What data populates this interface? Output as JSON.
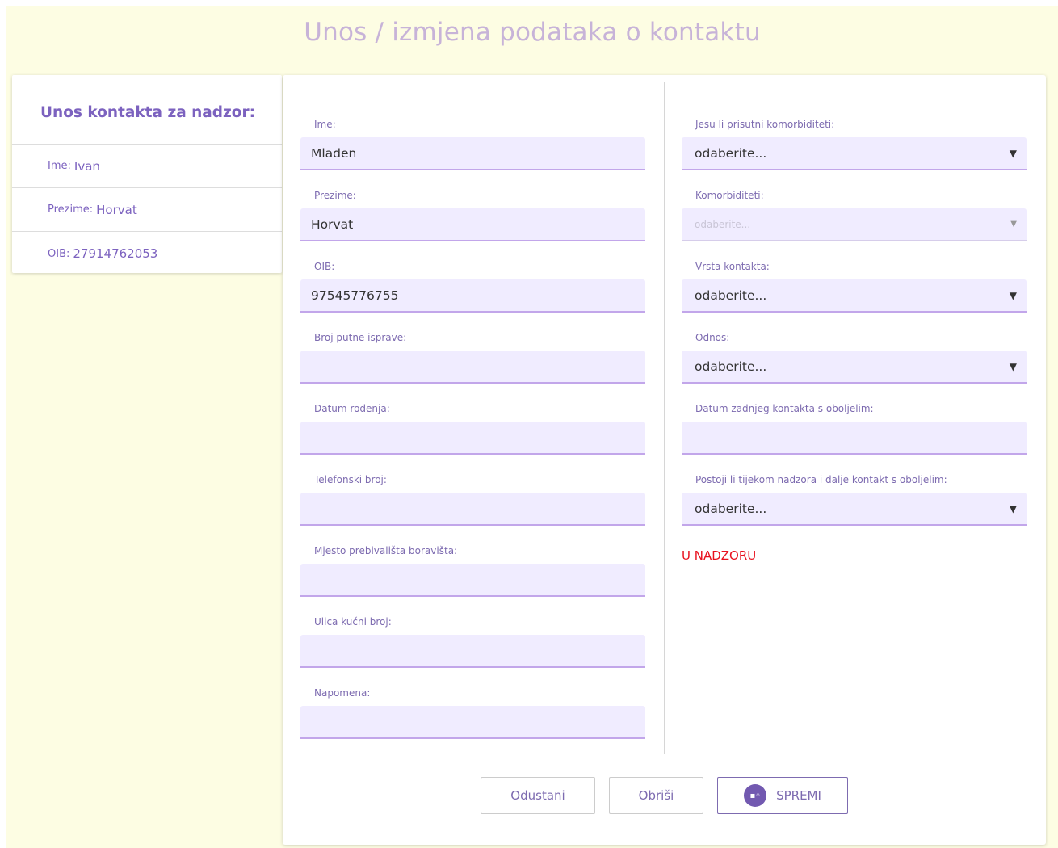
{
  "page_title": "Unos / izmjena podataka o kontaktu",
  "summary": {
    "heading": "Unos kontakta za nadzor:",
    "rows": [
      {
        "label": "Ime:",
        "value": "Ivan"
      },
      {
        "label": "Prezime:",
        "value": "Horvat"
      },
      {
        "label": "OIB:",
        "value": "27914762053"
      }
    ]
  },
  "form_left": [
    {
      "label": "Ime:",
      "value": "Mladen"
    },
    {
      "label": "Prezime:",
      "value": "Horvat"
    },
    {
      "label": "OIB:",
      "value": "97545776755"
    },
    {
      "label": "Broj putne isprave:",
      "value": ""
    },
    {
      "label": "Datum rođenja:",
      "value": ""
    },
    {
      "label": "Telefonski broj:",
      "value": ""
    },
    {
      "label": "Mjesto prebivališta boravišta:",
      "value": ""
    },
    {
      "label": "Ulica kućni broj:",
      "value": ""
    },
    {
      "label": "Napomena:",
      "value": ""
    }
  ],
  "form_right": [
    {
      "label": "Jesu li prisutni komorbiditeti:",
      "value": "odaberite..."
    },
    {
      "label": "Komorbiditeti:",
      "value": "odaberite..."
    },
    {
      "label": "Vrsta kontakta:",
      "value": "odaberite..."
    },
    {
      "label": "Odnos:",
      "value": "odaberite..."
    },
    {
      "label": "Datum zadnjeg kontakta s oboljelim:",
      "value": ""
    },
    {
      "label": "Postoji li tijekom nadzora i dalje kontakt s oboljelim:",
      "value": "odaberite..."
    }
  ],
  "status_text": "U NADZORU",
  "buttons": {
    "cancel": "Odustani",
    "delete": "Obriši",
    "save": "SPREMI"
  },
  "icons": {
    "caret": "▼",
    "save_icon": "save-disk-icon"
  },
  "colors": {
    "accent": "#7c62bf",
    "status": "#e8101d",
    "page_bg": "#fdfde3",
    "field_bg": "#f0ecff"
  }
}
